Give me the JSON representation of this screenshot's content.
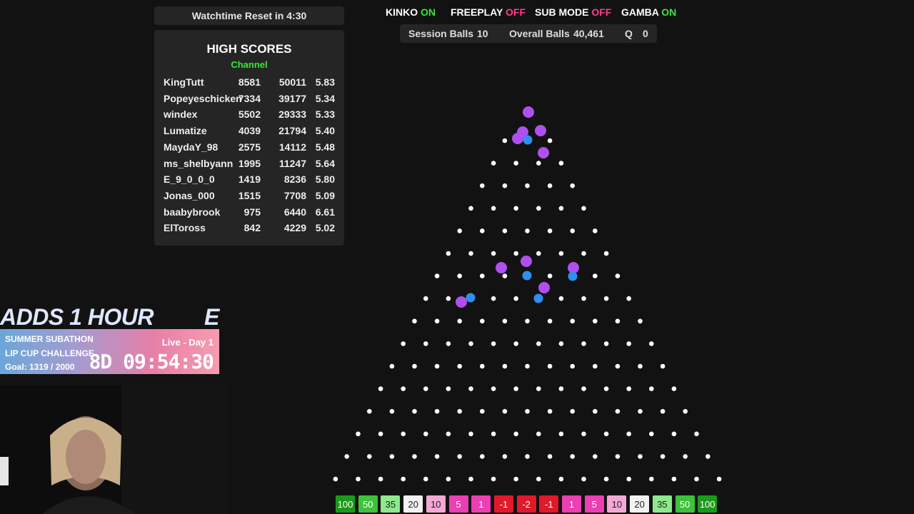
{
  "watchtime": "Watchtime Reset in 4:30",
  "high_scores": {
    "title": "HIGH SCORES",
    "subtitle": "Channel",
    "rows": [
      {
        "name": "KingTutt",
        "a": "8581",
        "b": "50011",
        "c": "5.83"
      },
      {
        "name": "Popeyeschicken",
        "a": "7334",
        "b": "39177",
        "c": "5.34"
      },
      {
        "name": "windex",
        "a": "5502",
        "b": "29333",
        "c": "5.33"
      },
      {
        "name": "Lumatize",
        "a": "4039",
        "b": "21794",
        "c": "5.40"
      },
      {
        "name": "MaydaY_98",
        "a": "2575",
        "b": "14112",
        "c": "5.48"
      },
      {
        "name": "ms_shelbyann",
        "a": "1995",
        "b": "11247",
        "c": "5.64"
      },
      {
        "name": "E_9_0_0_0",
        "a": "1419",
        "b": "8236",
        "c": "5.80"
      },
      {
        "name": "Jonas_000",
        "a": "1515",
        "b": "7708",
        "c": "5.09"
      },
      {
        "name": "baabybrook",
        "a": "975",
        "b": "6440",
        "c": "6.61"
      },
      {
        "name": "ElToross",
        "a": "842",
        "b": "4229",
        "c": "5.02"
      }
    ]
  },
  "modes": [
    {
      "label": "KINKO",
      "state": "ON"
    },
    {
      "label": "FREEPLAY",
      "state": "OFF"
    },
    {
      "label": "SUB MODE",
      "state": "OFF"
    },
    {
      "label": "GAMBA",
      "state": "ON"
    }
  ],
  "stats": {
    "session_label": "Session Balls",
    "session_value": "10",
    "overall_label": "Overall Balls",
    "overall_value": "40,461",
    "q_label": "Q",
    "q_value": "0"
  },
  "slots": [
    "100",
    "50",
    "35",
    "20",
    "10",
    "5",
    "1",
    "-1",
    "-2",
    "-1",
    "1",
    "5",
    "10",
    "20",
    "35",
    "50",
    "100"
  ],
  "colors": {
    "on": "#3ee33e",
    "off": "#ff3f8c",
    "ball_purple": "#b04ff0",
    "ball_blue": "#2f8ff0",
    "slot_dark_green": "#1a9a1a",
    "slot_green": "#3cc23c",
    "slot_light_green": "#8ee88e",
    "slot_white": "#f2f2f2",
    "slot_light_pink": "#f4a8d4",
    "slot_pink": "#ec3fb3",
    "slot_red": "#e01a2a"
  },
  "overlay": {
    "adds": "ADDS 1 HOUR",
    "adds_tail": "E",
    "event": "SUMMER SUBATHON",
    "challenge": "LIP CUP CHALLENGE",
    "goal": "Goal: 1319 / 2000",
    "live": "Live - Day 1",
    "timer": "8D 09:54:30"
  }
}
